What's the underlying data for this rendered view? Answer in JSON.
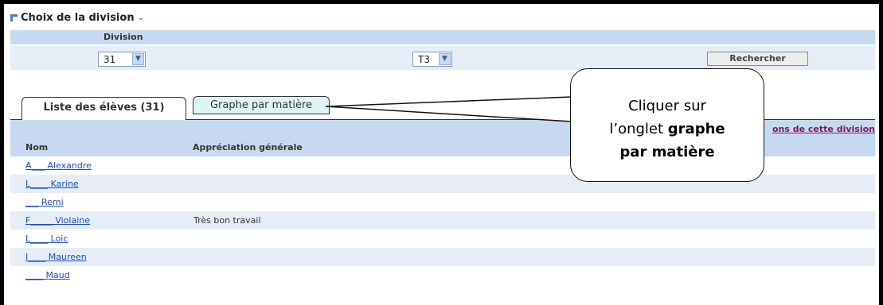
{
  "header": {
    "title": "Choix de la division",
    "chevron": "chevron-down-icon"
  },
  "filters": {
    "division_label": "Division",
    "division_value": "31",
    "period_value": "T3",
    "search_button": "Rechercher"
  },
  "tabs": [
    {
      "label": "Liste des élèves (31)",
      "active": true
    },
    {
      "label": "Graphe par matière",
      "active": false
    }
  ],
  "table": {
    "col_name": "Nom",
    "col_appreciation": "Appréciation générale",
    "header_link": "ons de cette division",
    "rows": [
      {
        "name": "A___ Alexandre",
        "appreciation": ""
      },
      {
        "name": "L____ Karine",
        "appreciation": ""
      },
      {
        "name": "___ Remi",
        "appreciation": ""
      },
      {
        "name": "F_____ Violaine",
        "appreciation": "Très bon travail"
      },
      {
        "name": "L____ Loic",
        "appreciation": ""
      },
      {
        "name": "I____ Maureen",
        "appreciation": ""
      },
      {
        "name": "____ Maud",
        "appreciation": ""
      }
    ]
  },
  "callout": {
    "line1": "Cliquer sur",
    "line2_normal": "l’onglet ",
    "line2_bold": "graphe",
    "line3_bold": "par matière"
  },
  "colors": {
    "band": "#c7d9f0",
    "row_alt": "#e6edf6",
    "tab_inactive": "#dcf5f5",
    "link": "#1a4fbf"
  }
}
